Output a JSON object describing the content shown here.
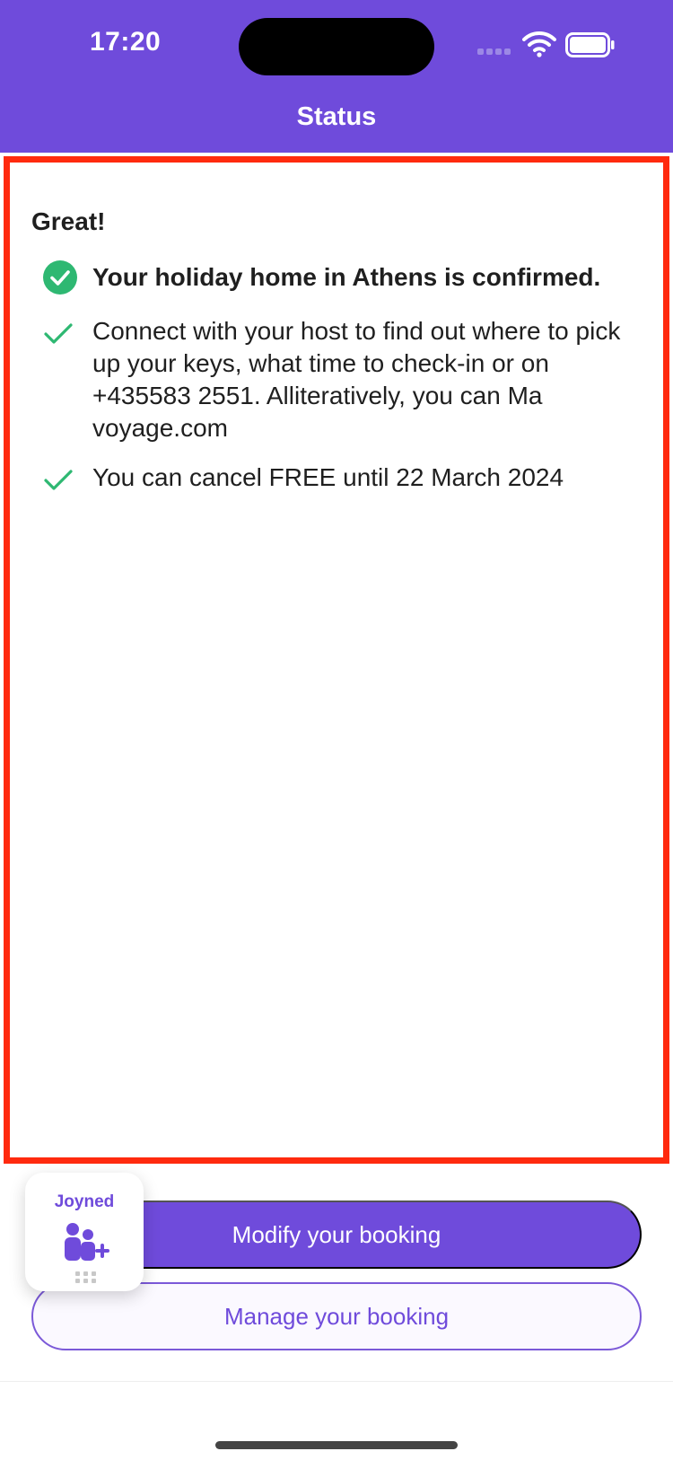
{
  "status_bar": {
    "time": "17:20",
    "icons": [
      "signal-icon",
      "wifi-icon",
      "battery-icon"
    ]
  },
  "header": {
    "title": "Status"
  },
  "content": {
    "greeting": "Great!",
    "items": [
      {
        "icon": "check-circle-icon",
        "text": "Your holiday home in Athens is confirmed.",
        "bold": true
      },
      {
        "icon": "check-icon",
        "text": "Connect with your host to find out where to pick up your keys, what time to check-in or on +435583 2551. Alliteratively, you can Ma voyage.com",
        "bold": false
      },
      {
        "icon": "check-icon",
        "text": "You can cancel FREE until 22 March 2024",
        "bold": false
      }
    ]
  },
  "actions": {
    "modify_label": "Modify your booking",
    "manage_label": "Manage your booking"
  },
  "widget": {
    "label": "Joyned",
    "icon": "group-add-icon"
  },
  "colors": {
    "brand": "#6f4bdb",
    "success": "#2eb872",
    "highlight_border": "#ff2a0e"
  }
}
